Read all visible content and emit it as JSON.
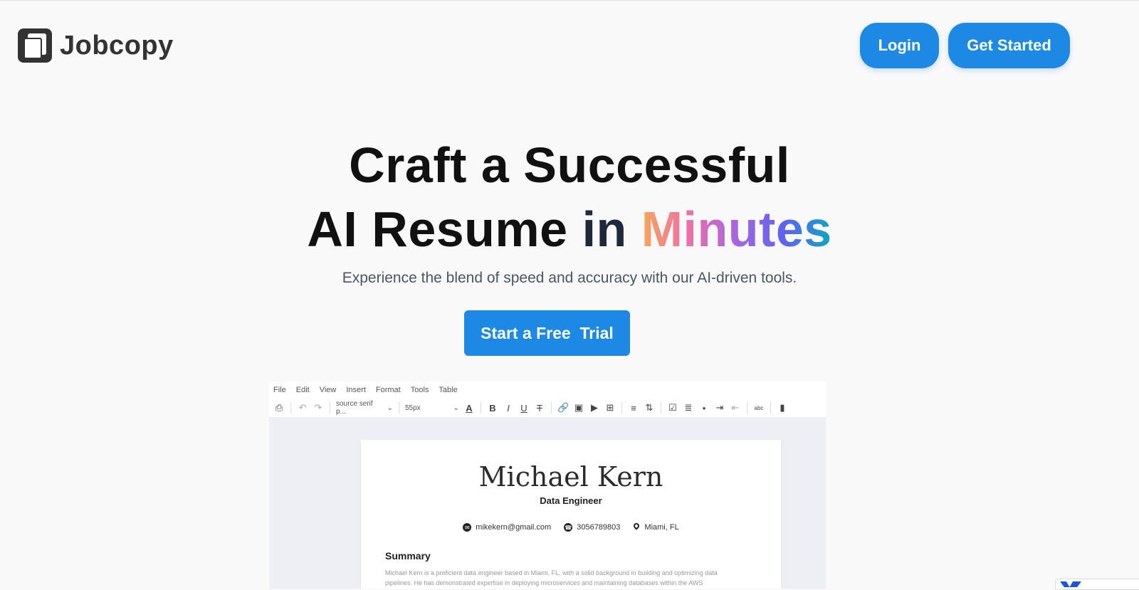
{
  "brand": {
    "name": "Jobcopy"
  },
  "nav": {
    "login": "Login",
    "get_started": "Get Started"
  },
  "hero": {
    "line1": "Craft a Successful",
    "line2_a": "AI Resume",
    "line2_in": "in",
    "line2_highlight": "Minutes",
    "subtitle": "Experience the blend of speed and accuracy with our AI-driven tools.",
    "cta": "Start a Free  Trial"
  },
  "editor": {
    "menu": [
      "File",
      "Edit",
      "View",
      "Insert",
      "Format",
      "Tools",
      "Table"
    ],
    "font": "source serif p...",
    "size": "55px"
  },
  "resume": {
    "name": "Michael Kern",
    "role": "Data Engineer",
    "email": "mikekern@gmail.com",
    "phone": "3056789803",
    "location": "Miami, FL",
    "summary_heading": "Summary",
    "summary_text": "Michael Kern is a proficient data engineer based in Miami, FL, with a solid background in building and optimizing data pipelines. He has demonstrated expertise in deploying microservices and maintaining databases within the AWS"
  },
  "colors": {
    "accent": "#1e88e5",
    "text": "#111111",
    "muted": "#4b5563"
  }
}
